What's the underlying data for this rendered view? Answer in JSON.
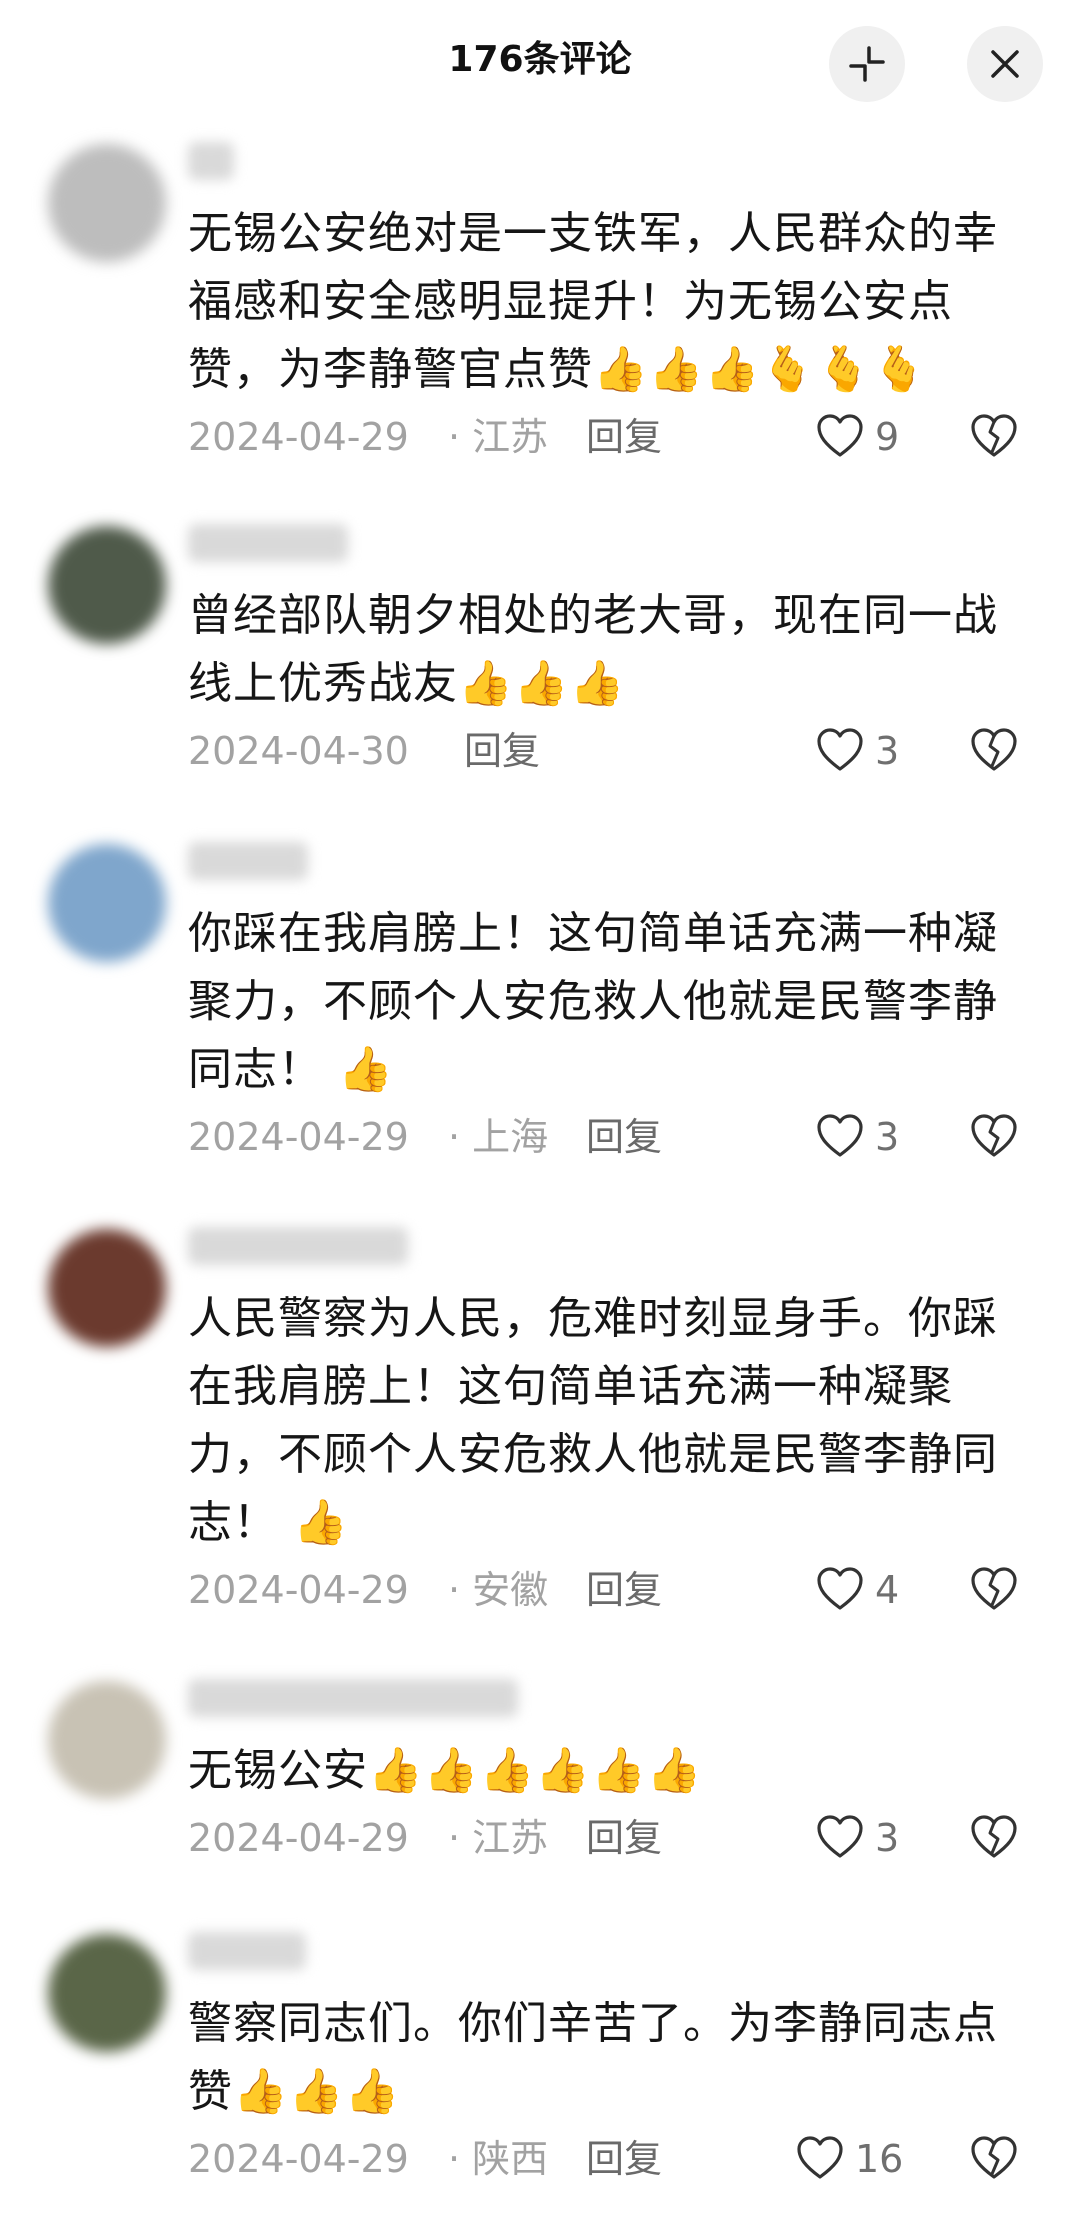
{
  "header": {
    "title": "176条评论"
  },
  "comments": [
    {
      "text": "无锡公安绝对是一支铁军，人民群众的幸福感和安全感明显提升！为无锡公安点赞，为李静警官点赞👍👍👍🫰🫰🫰",
      "date": "2024-04-29",
      "location": "· 江苏",
      "reply": "回复",
      "likes": "9",
      "avatar_color": "#bdbdbd"
    },
    {
      "text": "曾经部队朝夕相处的老大哥，现在同一战线上优秀战友👍👍👍",
      "date": "2024-04-30",
      "location": "",
      "reply": "回复",
      "likes": "3",
      "avatar_color": "#4f5a4a"
    },
    {
      "text": "你踩在我肩膀上！这句简单话充满一种凝聚力，不顾个人安危救人他就是民警李静同志！ 👍",
      "date": "2024-04-29",
      "location": "· 上海",
      "reply": "回复",
      "likes": "3",
      "avatar_color": "#7fa6cc"
    },
    {
      "text": "人民警察为人民，危难时刻显身手。你踩在我肩膀上！这句简单话充满一种凝聚力，不顾个人安危救人他就是民警李静同志！ 👍",
      "date": "2024-04-29",
      "location": "· 安徽",
      "reply": "回复",
      "likes": "4",
      "avatar_color": "#6b3a2e"
    },
    {
      "text": "无锡公安👍👍👍👍👍👍",
      "date": "2024-04-29",
      "location": "· 江苏",
      "reply": "回复",
      "likes": "3",
      "avatar_color": "#c8c2b4"
    },
    {
      "text": "警察同志们。你们辛苦了。为李静同志点赞👍👍👍",
      "date": "2024-04-29",
      "location": "· 陕西",
      "reply": "回复",
      "likes": "16",
      "avatar_color": "#5a6648"
    }
  ]
}
